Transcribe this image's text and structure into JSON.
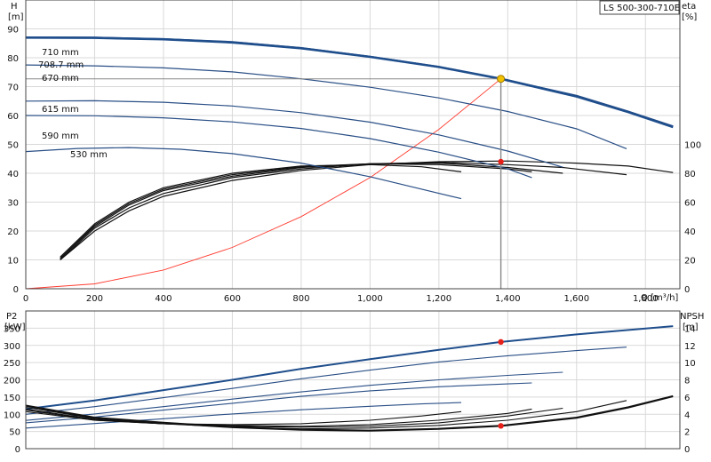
{
  "model": "LS 500-300-710E",
  "colors": {
    "head": "#2a4f86",
    "head_bold": "#1f4e8c",
    "eta": "#111111",
    "system": "#ff3b2f",
    "grid": "#d9d9d9",
    "op_point": "#f2c200",
    "marker": "#e8201a",
    "frame": "#444444"
  },
  "chart_data": [
    {
      "type": "line",
      "x_label": "Q [m³/h]",
      "left_axis": {
        "label_top": "H",
        "label_unit": "[m]",
        "ylim": [
          0,
          100
        ],
        "ticks": [
          0,
          10,
          20,
          30,
          40,
          50,
          60,
          70,
          80,
          90
        ]
      },
      "right_axis": {
        "label_top": "eta",
        "label_unit": "[%]",
        "ylim": [
          0,
          200
        ],
        "ticks": [
          0,
          20,
          40,
          60,
          80,
          100
        ]
      },
      "xlim": [
        0,
        1900
      ],
      "x_ticks": [
        0,
        200,
        400,
        600,
        800,
        1000,
        1200,
        1400,
        1600,
        1800
      ],
      "x_tick_labels": [
        "0",
        "200",
        "400",
        "600",
        "800",
        "1,000",
        "1,200",
        "1,400",
        "1,600",
        "1,800"
      ],
      "grid": true,
      "head_curves": [
        {
          "name": "710 mm",
          "bold": false,
          "points": [
            [
              0,
              87.2
            ],
            [
              200,
              87.1
            ],
            [
              400,
              86.6
            ],
            [
              600,
              85.6
            ],
            [
              800,
              83.5
            ],
            [
              1000,
              80.5
            ],
            [
              1200,
              77.0
            ],
            [
              1400,
              72.3
            ],
            [
              1600,
              67.0
            ],
            [
              1750,
              61.5
            ],
            [
              1880,
              56.4
            ]
          ]
        },
        {
          "name": "708.7 mm",
          "bold": true,
          "points": [
            [
              0,
              87.0
            ],
            [
              200,
              86.9
            ],
            [
              400,
              86.4
            ],
            [
              600,
              85.3
            ],
            [
              800,
              83.3
            ],
            [
              1000,
              80.3
            ],
            [
              1200,
              76.8
            ],
            [
              1380,
              72.7
            ],
            [
              1600,
              66.6
            ],
            [
              1750,
              61.2
            ],
            [
              1880,
              56.0
            ]
          ]
        },
        {
          "name": "670 mm",
          "bold": false,
          "points": [
            [
              0,
              77.5
            ],
            [
              200,
              77.2
            ],
            [
              400,
              76.5
            ],
            [
              600,
              75.1
            ],
            [
              800,
              72.7
            ],
            [
              1000,
              69.8
            ],
            [
              1200,
              66.1
            ],
            [
              1400,
              61.4
            ],
            [
              1600,
              55.4
            ],
            [
              1745,
              48.5
            ]
          ]
        },
        {
          "name": "615 mm",
          "bold": false,
          "points": [
            [
              0,
              65.0
            ],
            [
              200,
              65.1
            ],
            [
              400,
              64.6
            ],
            [
              600,
              63.3
            ],
            [
              800,
              61.0
            ],
            [
              1000,
              57.7
            ],
            [
              1200,
              53.3
            ],
            [
              1400,
              47.7
            ],
            [
              1560,
              42.1
            ]
          ]
        },
        {
          "name": "590 mm",
          "bold": false,
          "points": [
            [
              0,
              60.0
            ],
            [
              200,
              59.9
            ],
            [
              400,
              59.2
            ],
            [
              600,
              57.8
            ],
            [
              800,
              55.5
            ],
            [
              1000,
              52.0
            ],
            [
              1200,
              47.3
            ],
            [
              1400,
              41.5
            ],
            [
              1470,
              38.5
            ]
          ]
        },
        {
          "name": "530 mm",
          "bold": false,
          "points": [
            [
              0,
              47.5
            ],
            [
              150,
              48.6
            ],
            [
              300,
              48.9
            ],
            [
              450,
              48.3
            ],
            [
              600,
              46.8
            ],
            [
              800,
              43.5
            ],
            [
              1000,
              38.8
            ],
            [
              1150,
              34.5
            ],
            [
              1265,
              31.2
            ]
          ]
        }
      ],
      "eta_curves": [
        {
          "name": "eta 710 mm",
          "points": [
            [
              100,
              20
            ],
            [
              200,
              40
            ],
            [
              300,
              54
            ],
            [
              400,
              64
            ],
            [
              600,
              75
            ],
            [
              800,
              82
            ],
            [
              1000,
              86
            ],
            [
              1200,
              88
            ],
            [
              1400,
              88.5
            ],
            [
              1600,
              87
            ],
            [
              1750,
              85
            ],
            [
              1880,
              80.5
            ]
          ]
        },
        {
          "name": "eta 670 mm",
          "points": [
            [
              100,
              20
            ],
            [
              200,
              42
            ],
            [
              300,
              56
            ],
            [
              400,
              66
            ],
            [
              600,
              77
            ],
            [
              800,
              83
            ],
            [
              1000,
              86.5
            ],
            [
              1200,
              87.5
            ],
            [
              1400,
              86
            ],
            [
              1560,
              84
            ],
            [
              1745,
              79
            ]
          ]
        },
        {
          "name": "eta 615 mm",
          "points": [
            [
              100,
              21
            ],
            [
              200,
              43
            ],
            [
              300,
              58
            ],
            [
              400,
              68
            ],
            [
              600,
              78
            ],
            [
              800,
              84
            ],
            [
              1000,
              86.5
            ],
            [
              1200,
              87
            ],
            [
              1400,
              84
            ],
            [
              1560,
              80
            ]
          ]
        },
        {
          "name": "eta 590 mm",
          "points": [
            [
              100,
              21
            ],
            [
              200,
              44
            ],
            [
              300,
              59
            ],
            [
              400,
              69
            ],
            [
              600,
              79
            ],
            [
              800,
              84.5
            ],
            [
              1000,
              86.5
            ],
            [
              1200,
              86
            ],
            [
              1400,
              83
            ],
            [
              1470,
              81
            ]
          ]
        },
        {
          "name": "eta 530 mm",
          "points": [
            [
              100,
              22
            ],
            [
              200,
              45
            ],
            [
              300,
              60
            ],
            [
              400,
              70
            ],
            [
              600,
              80
            ],
            [
              800,
              85
            ],
            [
              1000,
              86
            ],
            [
              1150,
              84.5
            ],
            [
              1265,
              81
            ]
          ]
        }
      ],
      "system_curve": {
        "points": [
          [
            0,
            0
          ],
          [
            200,
            1.7
          ],
          [
            400,
            6.5
          ],
          [
            600,
            14.3
          ],
          [
            800,
            25.0
          ],
          [
            1000,
            38.5
          ],
          [
            1200,
            55.2
          ],
          [
            1380,
            72.7
          ]
        ]
      },
      "operating_point": {
        "q": 1380,
        "h": 72.7,
        "eta": 88
      }
    },
    {
      "type": "line",
      "x_label": "",
      "left_axis": {
        "label_top": "P2",
        "label_unit": "[kW]",
        "ylim": [
          0,
          400
        ],
        "ticks": [
          0,
          50,
          100,
          150,
          200,
          250,
          300,
          350
        ]
      },
      "right_axis": {
        "label_top": "NPSH",
        "label_unit": "[m]",
        "ylim": [
          0,
          16
        ],
        "ticks": [
          0,
          2,
          4,
          6,
          8,
          10,
          12,
          14
        ]
      },
      "xlim": [
        0,
        1900
      ],
      "grid": true,
      "power_curves": [
        {
          "name": "P2 710 mm",
          "bold": true,
          "points": [
            [
              0,
              115
            ],
            [
              200,
              140
            ],
            [
              400,
              170
            ],
            [
              600,
              200
            ],
            [
              800,
              232
            ],
            [
              1000,
              260
            ],
            [
              1200,
              287
            ],
            [
              1380,
              310
            ],
            [
              1600,
              332
            ],
            [
              1880,
              356
            ]
          ]
        },
        {
          "name": "P2 670 mm",
          "bold": false,
          "points": [
            [
              0,
              100
            ],
            [
              200,
              122
            ],
            [
              400,
              148
            ],
            [
              600,
              175
            ],
            [
              800,
              203
            ],
            [
              1000,
              228
            ],
            [
              1200,
              252
            ],
            [
              1400,
              270
            ],
            [
              1600,
              285
            ],
            [
              1745,
              295
            ]
          ]
        },
        {
          "name": "P2 615 mm",
          "bold": false,
          "points": [
            [
              0,
              82
            ],
            [
              200,
              101
            ],
            [
              400,
              122
            ],
            [
              600,
              144
            ],
            [
              800,
              165
            ],
            [
              1000,
              184
            ],
            [
              1200,
              200
            ],
            [
              1400,
              213
            ],
            [
              1560,
              222
            ]
          ]
        },
        {
          "name": "P2 590 mm",
          "bold": false,
          "points": [
            [
              0,
              75
            ],
            [
              200,
              92
            ],
            [
              400,
              112
            ],
            [
              600,
              132
            ],
            [
              800,
              152
            ],
            [
              1000,
              168
            ],
            [
              1200,
              180
            ],
            [
              1400,
              188
            ],
            [
              1470,
              191
            ]
          ]
        },
        {
          "name": "P2 530 mm",
          "bold": false,
          "points": [
            [
              0,
              60
            ],
            [
              200,
              73
            ],
            [
              400,
              87
            ],
            [
              600,
              101
            ],
            [
              800,
              113
            ],
            [
              1000,
              123
            ],
            [
              1150,
              130
            ],
            [
              1265,
              134
            ]
          ]
        }
      ],
      "npsh_curves": [
        {
          "name": "NPSH 710 mm",
          "bold": true,
          "points": [
            [
              0,
              5.0
            ],
            [
              200,
              3.6
            ],
            [
              400,
              3.0
            ],
            [
              600,
              2.5
            ],
            [
              800,
              2.2
            ],
            [
              1000,
              2.1
            ],
            [
              1200,
              2.3
            ],
            [
              1380,
              2.65
            ],
            [
              1600,
              3.6
            ],
            [
              1750,
              4.8
            ],
            [
              1880,
              6.1
            ]
          ]
        },
        {
          "name": "NPSH 670 mm",
          "bold": false,
          "points": [
            [
              0,
              4.8
            ],
            [
              200,
              3.5
            ],
            [
              400,
              2.9
            ],
            [
              600,
              2.5
            ],
            [
              800,
              2.3
            ],
            [
              1000,
              2.4
            ],
            [
              1200,
              2.7
            ],
            [
              1400,
              3.3
            ],
            [
              1600,
              4.3
            ],
            [
              1745,
              5.6
            ]
          ]
        },
        {
          "name": "NPSH 615 mm",
          "bold": false,
          "points": [
            [
              0,
              4.6
            ],
            [
              200,
              3.4
            ],
            [
              400,
              2.9
            ],
            [
              600,
              2.6
            ],
            [
              800,
              2.5
            ],
            [
              1000,
              2.6
            ],
            [
              1200,
              3.0
            ],
            [
              1400,
              3.8
            ],
            [
              1560,
              4.7
            ]
          ]
        },
        {
          "name": "NPSH 590 mm",
          "bold": false,
          "points": [
            [
              0,
              4.5
            ],
            [
              200,
              3.3
            ],
            [
              400,
              2.9
            ],
            [
              600,
              2.7
            ],
            [
              800,
              2.6
            ],
            [
              1000,
              2.8
            ],
            [
              1200,
              3.3
            ],
            [
              1400,
              4.1
            ],
            [
              1470,
              4.6
            ]
          ]
        },
        {
          "name": "NPSH 530 mm",
          "bold": false,
          "points": [
            [
              0,
              4.3
            ],
            [
              200,
              3.3
            ],
            [
              400,
              2.9
            ],
            [
              600,
              2.8
            ],
            [
              800,
              2.9
            ],
            [
              1000,
              3.3
            ],
            [
              1150,
              3.8
            ],
            [
              1265,
              4.3
            ]
          ]
        }
      ],
      "operating_point": {
        "q": 1380,
        "p2": 310,
        "npsh": 2.65
      }
    }
  ]
}
